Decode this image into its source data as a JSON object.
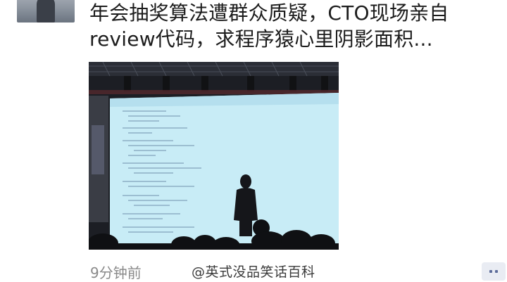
{
  "post": {
    "text_line1": "年会抽奖算法遭群众质疑，CTO现场亲自",
    "text_line2": "review代码，求程序猿心里阴影面积...",
    "photo_icon": "presentation-photo",
    "time": "9分钟前",
    "watermark": "@英式没品笑话百科",
    "comment_icon": "comment-dots-icon"
  },
  "colors": {
    "time_text": "#8a8a8a",
    "comment_bg": "#e9ecf3",
    "comment_dots": "#5d6d9b"
  }
}
